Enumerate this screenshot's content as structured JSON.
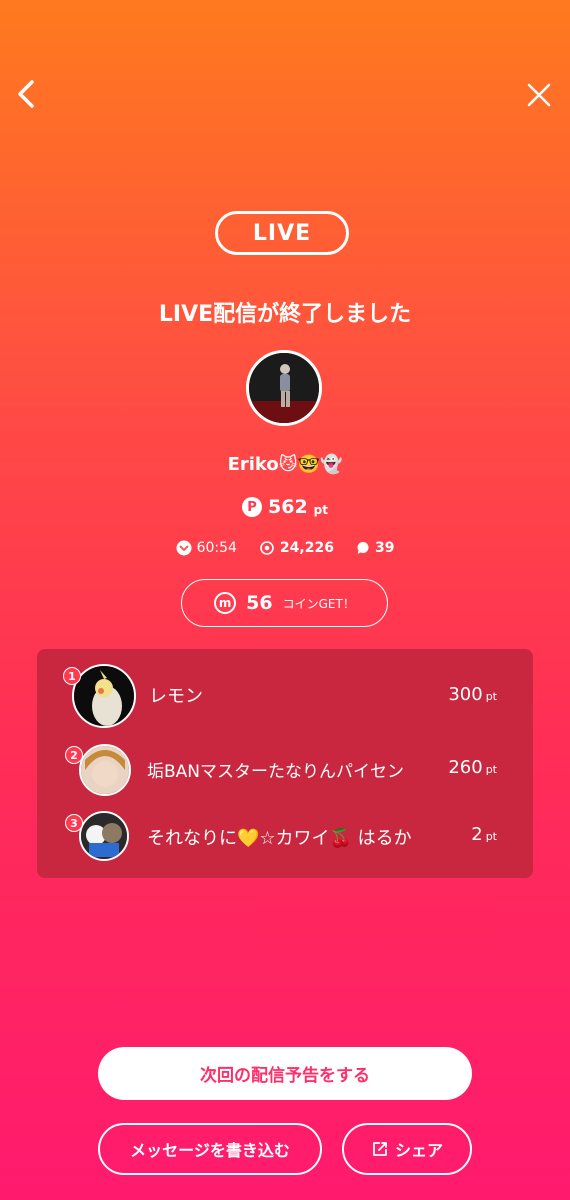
{
  "header": {
    "back_icon": "chevron-left-icon",
    "close_icon": "close-icon"
  },
  "live_badge": "LIVE",
  "title": "LIVE配信が終了しました",
  "streamer": {
    "name": "Eriko😼🤓👻",
    "points": "562",
    "points_unit": "pt",
    "points_icon_letter": "P"
  },
  "stats": {
    "duration": "60:54",
    "viewers": "24,226",
    "comments": "39"
  },
  "coin": {
    "icon_letter": "m",
    "value": "56",
    "label": "コインGET！"
  },
  "ranking": [
    {
      "rank": "1",
      "name": "レモン",
      "points": "300",
      "unit": "pt"
    },
    {
      "rank": "2",
      "name": "垢BANマスターたなりんパイセン",
      "points": "260",
      "unit": "pt"
    },
    {
      "rank": "3",
      "name": "それなりに💛☆カワイ🍒 はるか",
      "points": "2",
      "unit": "pt"
    }
  ],
  "buttons": {
    "next_schedule": "次回の配信予告をする",
    "write_message": "メッセージを書き込む",
    "share": "シェア"
  },
  "colors": {
    "accent": "#ff2f6a",
    "panel": "#c8273f",
    "gradient_top": "#ff7a1e",
    "gradient_bottom": "#ff1a6e"
  }
}
